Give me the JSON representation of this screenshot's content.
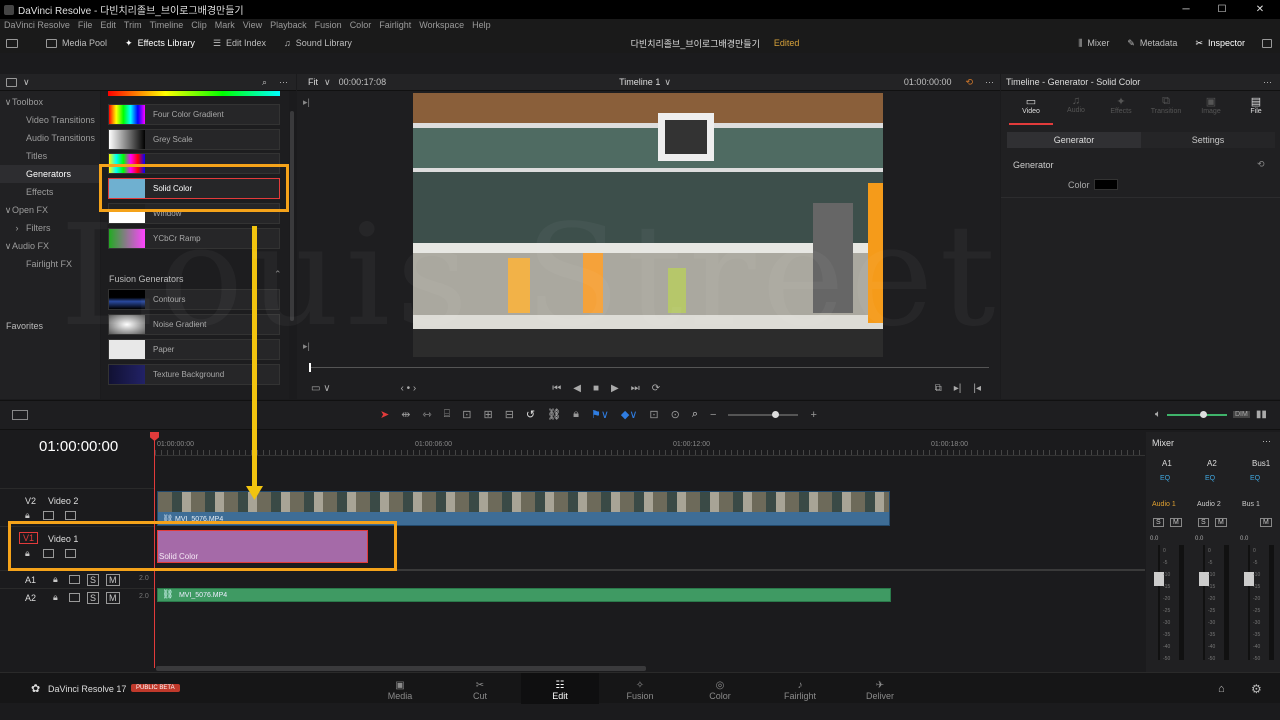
{
  "window": {
    "title": "DaVinci Resolve - 다빈치리졸브_브이로그배경만들기",
    "minimize": "─",
    "maximize": "☐",
    "close": "✕"
  },
  "menu": [
    "DaVinci Resolve",
    "File",
    "Edit",
    "Trim",
    "Timeline",
    "Clip",
    "Mark",
    "View",
    "Playback",
    "Fusion",
    "Color",
    "Fairlight",
    "Workspace",
    "Help"
  ],
  "toolbar": {
    "media_pool": "Media Pool",
    "effects_library": "Effects Library",
    "edit_index": "Edit Index",
    "sound_library": "Sound Library",
    "project_name": "다빈치리졸브_브이로그배경만들기",
    "project_status": "Edited",
    "mixer": "Mixer",
    "metadata": "Metadata",
    "inspector": "Inspector"
  },
  "viewer_header": {
    "zoom": "Fit",
    "duration": "00:00:17:08",
    "timeline_name": "Timeline 1",
    "timecode": "01:00:00:00"
  },
  "inspector_header": {
    "title": "Timeline - Generator - Solid Color"
  },
  "sidebar": {
    "items": [
      {
        "label": "Toolbox",
        "arrow": "∨",
        "indent": 0
      },
      {
        "label": "Video Transitions",
        "arrow": "",
        "indent": 1
      },
      {
        "label": "Audio Transitions",
        "arrow": "",
        "indent": 1
      },
      {
        "label": "Titles",
        "arrow": "",
        "indent": 1
      },
      {
        "label": "Generators",
        "arrow": "",
        "indent": 1,
        "active": true
      },
      {
        "label": "Effects",
        "arrow": "",
        "indent": 1
      },
      {
        "label": "Open FX",
        "arrow": "∨",
        "indent": 0
      },
      {
        "label": "Filters",
        "arrow": "›",
        "indent": 1
      },
      {
        "label": "Audio FX",
        "arrow": "∨",
        "indent": 0
      },
      {
        "label": "Fairlight FX",
        "arrow": "",
        "indent": 1
      }
    ],
    "favorites": "Favorites"
  },
  "generators": [
    {
      "label": "Four Color Gradient"
    },
    {
      "label": "Grey Scale"
    },
    {
      "label": "Solid Color"
    },
    {
      "label": "Window"
    },
    {
      "label": "YCbCr Ramp"
    }
  ],
  "fusion_generators": {
    "title": "Fusion Generators",
    "items": [
      {
        "label": "Contours"
      },
      {
        "label": "Noise Gradient"
      },
      {
        "label": "Paper"
      },
      {
        "label": "Texture Background"
      }
    ]
  },
  "inspector": {
    "tabs": [
      "Video",
      "Audio",
      "Effects",
      "Transition",
      "Image",
      "File"
    ],
    "subtabs": [
      "Generator",
      "Settings"
    ],
    "section": "Generator",
    "color_label": "Color"
  },
  "timeline": {
    "timecode": "01:00:00:00",
    "ruler": [
      "01:00:00:00",
      "01:00:06:00",
      "01:00:12:00",
      "01:00:18:00"
    ],
    "tracks": [
      {
        "id": "V2",
        "name": "Video 2"
      },
      {
        "id": "V1",
        "name": "Video 1"
      },
      {
        "id": "A1",
        "name": "",
        "level": "2.0"
      },
      {
        "id": "A2",
        "name": "",
        "level": "2.0"
      }
    ],
    "clips": {
      "v2_clip": "MVI_5076.MP4",
      "v1_clip": "Solid Color",
      "a2_clip": "MVI_5076.MP4"
    }
  },
  "mixer": {
    "title": "Mixer",
    "channels": [
      "A1",
      "A2",
      "Bus1"
    ],
    "eq": "EQ",
    "strips": [
      "Audio 1",
      "Audio 2",
      "Bus 1"
    ],
    "levels": [
      "0.0",
      "0.0",
      "0.0"
    ],
    "scale": [
      "0",
      "-5",
      "-10",
      "-15",
      "-20",
      "-25",
      "-30",
      "-35",
      "-40",
      "-50"
    ]
  },
  "footer": {
    "app": "DaVinci Resolve 17",
    "badge": "PUBLIC BETA",
    "pages": [
      "Media",
      "Cut",
      "Edit",
      "Fusion",
      "Color",
      "Fairlight",
      "Deliver"
    ],
    "active_page": "Edit"
  },
  "colors": {
    "accent_orange": "#f5a31a",
    "solid_clip": "#a56aa8",
    "video_clip": "#3e6d96",
    "audio_clip": "#3f9a63",
    "playhead": "#e23b3b"
  }
}
